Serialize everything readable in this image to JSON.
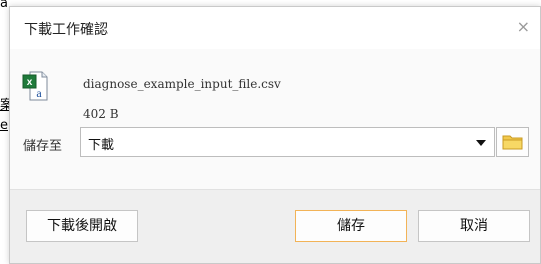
{
  "background": {
    "fragment_top": "a",
    "link_1": "案",
    "link_2": "e"
  },
  "dialog": {
    "title": "下載工作確認",
    "close_glyph": "×",
    "file": {
      "icon": "excel-csv-file-icon",
      "name": "diagnose_example_input_file.csv",
      "size": "402 B"
    },
    "save_to": {
      "label": "儲存至",
      "selected": "下載",
      "folder_icon": "folder-icon"
    },
    "buttons": {
      "open_after": "下載後開啟",
      "save": "儲存",
      "cancel": "取消"
    }
  },
  "colors": {
    "primary_border": "#f2b357",
    "folder": "#f1c84b",
    "excel_green": "#1f7a3a"
  }
}
